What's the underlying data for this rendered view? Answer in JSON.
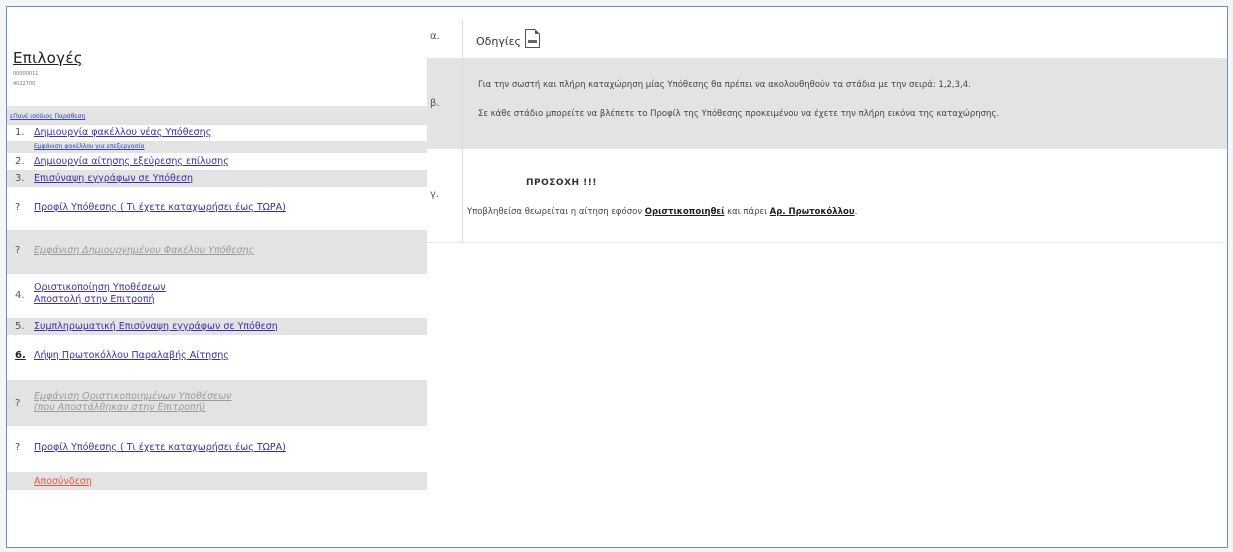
{
  "left": {
    "title": "Επιλογές",
    "ids": [
      "00000011",
      "4022700"
    ],
    "top_link": "εΠανέ ισόδιος Παράθεση",
    "items": [
      {
        "num": "1.",
        "label": "Δημιουργία φακέλλου νέας Υπόθεσης"
      },
      {
        "num": "",
        "label": "Εμφάνιση φακέλλου για επεξεργασία"
      },
      {
        "num": "2.",
        "label": "Δημιουργία αίτησης εξεύρεσης επίλυσης"
      },
      {
        "num": "3.",
        "label": "Επισύναψη εγγράφων σε Υπόθεση"
      },
      {
        "num": "?",
        "label": "Προφίλ Υπόθεσης ( Τι έχετε καταχωρήσει έως ΤΩΡΑ)"
      },
      {
        "num": "?",
        "label": "Εμφάνιση Δημιουργημένου Φακέλου Υπόθεσης"
      },
      {
        "num": "4.",
        "label": "Οριστικοποίηση Υποθέσεων",
        "label2": "Αποστολή στην Επιτροπή"
      },
      {
        "num": "5.",
        "label": "Συμπληρωματική Επισύναψη εγγράφων σε Υπόθεση"
      },
      {
        "num": "6.",
        "label": "Λήψη Πρωτοκόλλου Παραλαβής Αίτησης"
      },
      {
        "num": "?",
        "label": "Εμφάνιση Οριστικοποιημένων Υποθέσεων",
        "label2": "(που Αποστάλθηκαν στην Επιτροπή)"
      },
      {
        "num": "?",
        "label": "Προφίλ Υπόθεσης ( Τι έχετε καταχωρήσει έως ΤΩΡΑ)"
      },
      {
        "num": "",
        "label": "Αποσύνδεση"
      }
    ]
  },
  "right": {
    "a_label": "α.",
    "instructions_title": "Οδηγίες",
    "instructions_icon": "document-icon",
    "b_label": "β.",
    "b_line1": "Για την σωστή και πλήρη καταχώρηση μίας Υπόθεσης θα πρέπει να ακολουθηθούν τα στάδια με την σειρά: 1,2,3,4.",
    "b_line2": "Σε κάθε στάδιο μπορείτε να βλέπετε το Προφίλ της Υπόθεσης προκειμένου να έχετε την πλήρη εικόνα της καταχώρησης.",
    "c_label": "γ.",
    "warning": "ΠΡΟΣΟΧΗ !!!",
    "sub_pre": "Υποβληθείσα θεωρείται η αίτηση εφόσον ",
    "sub_bold1": "Οριστικοποιηθεί",
    "sub_mid": " και πάρει ",
    "sub_bold2": "Αρ. Πρωτοκόλλου",
    "sub_end": "."
  },
  "colors": {
    "link": "#3b2fa8",
    "disabled": "#9a9a9a",
    "logout": "#e05a3e",
    "border": "#6d8fc2"
  }
}
